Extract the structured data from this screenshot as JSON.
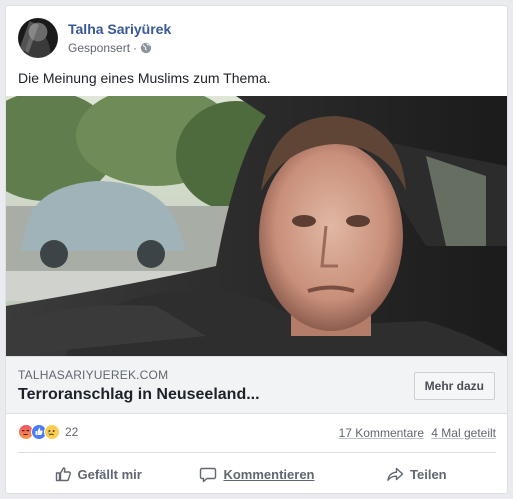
{
  "post": {
    "author": "Talha Sariyürek",
    "sponsored_label": "Gesponsert",
    "separator": "·",
    "text": "Die Meinung eines Muslims zum Thema.",
    "privacy_icon": "globe-icon"
  },
  "link_preview": {
    "image_icon": "video-thumbnail",
    "domain": "TALHASARIYUEREK.COM",
    "title": "Terroranschlag in Neuseeland...",
    "cta_label": "Mehr dazu"
  },
  "stats": {
    "reactions": [
      "angry-icon",
      "like-icon",
      "sad-icon"
    ],
    "reaction_count": "22",
    "comments": "17 Kommentare",
    "shares": "4 Mal geteilt"
  },
  "actions": {
    "like": "Gefällt mir",
    "comment": "Kommentieren",
    "share": "Teilen"
  },
  "colors": {
    "name": "#385898",
    "background": "#e9ebee",
    "link_bar": "#f2f3f5"
  }
}
